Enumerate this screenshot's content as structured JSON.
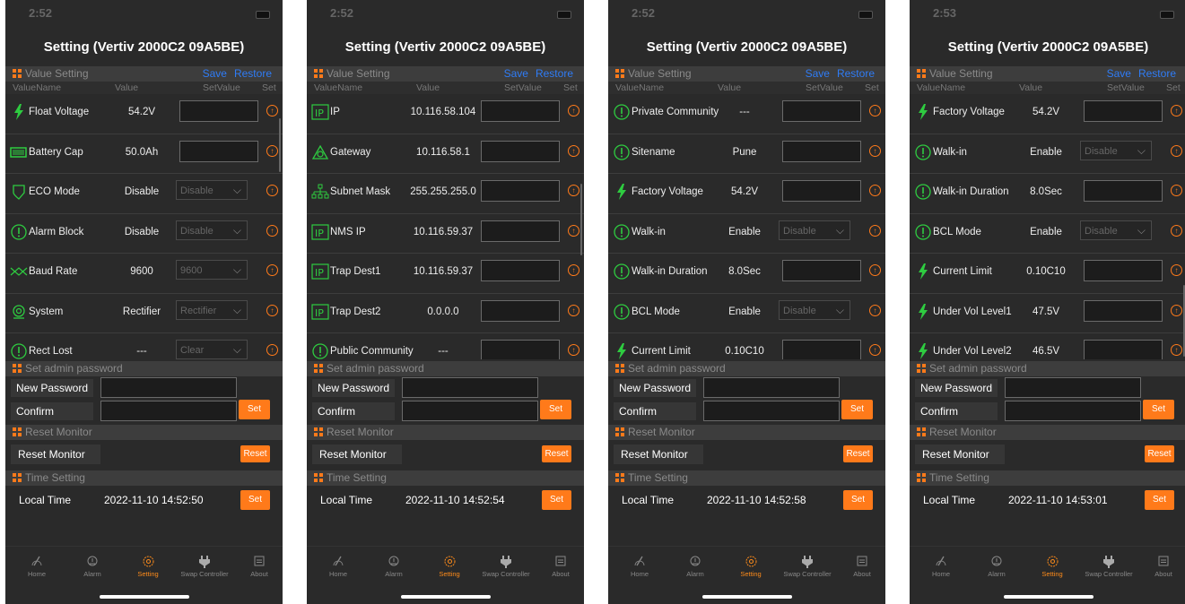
{
  "screens": [
    {
      "time": "2:52",
      "title": "Setting (Vertiv 2000C2 09A5BE)",
      "rows": [
        {
          "name": "Float Voltage",
          "value": "54.2V",
          "kind": "input",
          "icon": "bolt-icon"
        },
        {
          "name": "Battery Cap",
          "value": "50.0Ah",
          "kind": "input",
          "icon": "battery-icon"
        },
        {
          "name": "ECO Mode",
          "value": "Disable",
          "kind": "select",
          "option": "Disable",
          "icon": "shield-icon"
        },
        {
          "name": "Alarm Block",
          "value": "Disable",
          "kind": "select",
          "option": "Disable",
          "icon": "alert-icon"
        },
        {
          "name": "Baud Rate",
          "value": "9600",
          "kind": "select",
          "option": "9600",
          "icon": "baud-icon"
        },
        {
          "name": "System",
          "value": "Rectifier",
          "kind": "select",
          "option": "Rectifier",
          "icon": "system-icon"
        },
        {
          "name": "Rect Lost",
          "value": "---",
          "kind": "select",
          "option": "Clear",
          "icon": "alert-icon"
        }
      ],
      "local_time": "2022-11-10 14:52:50"
    },
    {
      "time": "2:52",
      "title": "Setting (Vertiv 2000C2 09A5BE)",
      "rows": [
        {
          "name": "IP",
          "value": "10.116.58.104",
          "kind": "input",
          "icon": "ip-icon"
        },
        {
          "name": "Gateway",
          "value": "10.116.58.1",
          "kind": "input",
          "icon": "gateway-icon"
        },
        {
          "name": "Subnet Mask",
          "value": "255.255.255.0",
          "kind": "input",
          "icon": "network-icon"
        },
        {
          "name": "NMS IP",
          "value": "10.116.59.37",
          "kind": "input",
          "icon": "ip-icon"
        },
        {
          "name": "Trap Dest1",
          "value": "10.116.59.37",
          "kind": "input",
          "icon": "ip-icon"
        },
        {
          "name": "Trap Dest2",
          "value": "0.0.0.0",
          "kind": "input",
          "icon": "ip-icon"
        },
        {
          "name": "Public Community",
          "value": "---",
          "kind": "input",
          "icon": "alert-icon"
        }
      ],
      "local_time": "2022-11-10 14:52:54"
    },
    {
      "time": "2:52",
      "title": "Setting (Vertiv 2000C2 09A5BE)",
      "rows": [
        {
          "name": "Private Community",
          "value": "---",
          "kind": "input",
          "icon": "alert-icon"
        },
        {
          "name": "Sitename",
          "value": "Pune",
          "kind": "input",
          "icon": "alert-icon"
        },
        {
          "name": "Factory Voltage",
          "value": "54.2V",
          "kind": "input",
          "icon": "bolt-icon"
        },
        {
          "name": "Walk-in",
          "value": "Enable",
          "kind": "select",
          "option": "Disable",
          "icon": "alert-icon"
        },
        {
          "name": "Walk-in Duration",
          "value": "8.0Sec",
          "kind": "input",
          "icon": "alert-icon"
        },
        {
          "name": "BCL Mode",
          "value": "Enable",
          "kind": "select",
          "option": "Disable",
          "icon": "alert-icon"
        },
        {
          "name": "Current Limit",
          "value": "0.10C10",
          "kind": "input",
          "icon": "bolt-icon"
        }
      ],
      "local_time": "2022-11-10 14:52:58"
    },
    {
      "time": "2:53",
      "title": "Setting (Vertiv 2000C2 09A5BE)",
      "rows": [
        {
          "name": "Factory Voltage",
          "value": "54.2V",
          "kind": "input",
          "icon": "bolt-icon"
        },
        {
          "name": "Walk-in",
          "value": "Enable",
          "kind": "select",
          "option": "Disable",
          "icon": "alert-icon"
        },
        {
          "name": "Walk-in Duration",
          "value": "8.0Sec",
          "kind": "input",
          "icon": "alert-icon"
        },
        {
          "name": "BCL Mode",
          "value": "Enable",
          "kind": "select",
          "option": "Disable",
          "icon": "alert-icon"
        },
        {
          "name": "Current Limit",
          "value": "0.10C10",
          "kind": "input",
          "icon": "bolt-icon"
        },
        {
          "name": "Under Vol Level1",
          "value": "47.5V",
          "kind": "input",
          "icon": "bolt-icon"
        },
        {
          "name": "Under Vol Level2",
          "value": "46.5V",
          "kind": "input",
          "icon": "bolt-icon"
        }
      ],
      "local_time": "2022-11-10 14:53:01"
    }
  ],
  "labels": {
    "value_setting": "Value Setting",
    "save": "Save",
    "restore": "Restore",
    "col_name": "ValueName",
    "col_value": "Value",
    "col_setvalue": "SetValue",
    "col_set": "Set",
    "admin_section": "Set admin password",
    "new_password": "New Password",
    "confirm": "Confirm",
    "set": "Set",
    "reset_section": "Reset Monitor",
    "reset_label": "Reset Monitor",
    "reset": "Reset",
    "time_section": "Time Setting",
    "local_time": "Local Time"
  },
  "tabs": [
    {
      "label": "Home",
      "icon": "gauge-icon"
    },
    {
      "label": "Alarm",
      "icon": "alarm-icon"
    },
    {
      "label": "Setting",
      "icon": "gear-icon",
      "active": true
    },
    {
      "label": "Swap Controller",
      "icon": "plug-icon"
    },
    {
      "label": "About",
      "icon": "info-icon"
    }
  ],
  "colors": {
    "accent": "#ff7a1a",
    "link": "#2f7cf6",
    "icon_green": "#2ecc40",
    "background": "#2a2a2a"
  }
}
